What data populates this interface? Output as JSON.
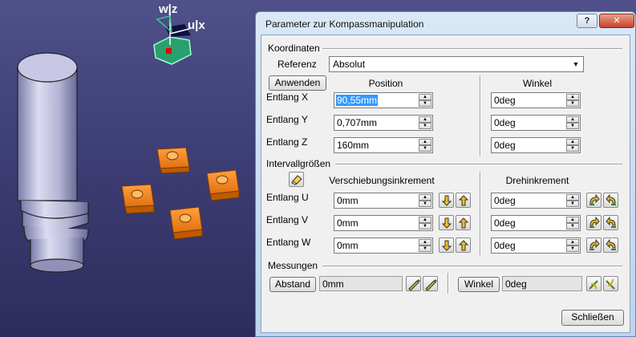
{
  "dialog": {
    "title": "Parameter zur Kompassmanipulation",
    "help_label": "?",
    "close_label": "✕"
  },
  "compass": {
    "w_z": "w|z",
    "u_x": "u|x"
  },
  "coordinates": {
    "group_label": "Koordinaten",
    "reference_label": "Referenz",
    "reference_value": "Absolut",
    "apply_label": "Anwenden",
    "position_header": "Position",
    "angle_header": "Winkel",
    "rows": [
      {
        "label": "Entlang X",
        "position": "90,55mm",
        "angle": "0deg"
      },
      {
        "label": "Entlang Y",
        "position": "0,707mm",
        "angle": "0deg"
      },
      {
        "label": "Entlang Z",
        "position": "160mm",
        "angle": "0deg"
      }
    ]
  },
  "intervals": {
    "group_label": "Intervallgrößen",
    "translation_header": "Verschiebungsinkrement",
    "rotation_header": "Drehinkrement",
    "rows": [
      {
        "label": "Entlang U",
        "translation": "0mm",
        "rotation": "0deg"
      },
      {
        "label": "Entlang V",
        "translation": "0mm",
        "rotation": "0deg"
      },
      {
        "label": "Entlang W",
        "translation": "0mm",
        "rotation": "0deg"
      }
    ]
  },
  "measurements": {
    "group_label": "Messungen",
    "distance_label": "Abstand",
    "distance_value": "0mm",
    "angle_label": "Winkel",
    "angle_value": "0deg"
  },
  "footer": {
    "close_label": "Schließen"
  },
  "colors": {
    "accent": "#3399ff",
    "part_orange": "#f08a28",
    "background": "#3e3e76"
  }
}
